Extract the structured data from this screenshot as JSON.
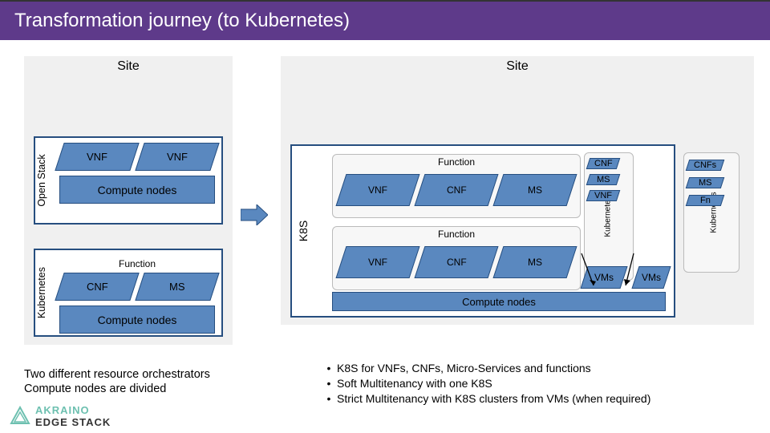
{
  "title": "Transformation journey (to Kubernetes)",
  "left_site": {
    "label": "Site",
    "openstack": {
      "vlabel": "Open Stack",
      "vnf1": "VNF",
      "vnf2": "VNF",
      "compute": "Compute nodes"
    },
    "kubernetes": {
      "vlabel": "Kubernetes",
      "function_label": "Function",
      "cnf": "CNF",
      "ms": "MS",
      "compute": "Compute nodes"
    }
  },
  "right_site": {
    "label": "Site",
    "k8s_vlabel": "K8S",
    "fn1": {
      "label": "Function",
      "vnf": "VNF",
      "cnf": "CNF",
      "ms": "MS"
    },
    "fn2": {
      "label": "Function",
      "vnf": "VNF",
      "cnf": "CNF",
      "ms": "MS"
    },
    "compute": "Compute nodes",
    "kub_inner": {
      "vlabel": "Kubernetes",
      "cnf": "CNF",
      "ms": "MS",
      "vnf": "VNF"
    },
    "kub_outer": {
      "vlabel": "Kubernetes",
      "cnfs": "CNFs",
      "ms": "MS",
      "fn": "Fn"
    },
    "vms_left": "VMs",
    "vms_right": "VMs"
  },
  "left_caption_line1": "Two different resource orchestrators",
  "left_caption_line2": "Compute nodes are divided",
  "bullets": [
    "K8S for VNFs, CNFs, Micro-Services and functions",
    "Soft Multitenancy with one K8S",
    "Strict Multitenancy with K8S clusters from VMs (when required)"
  ],
  "logo": {
    "part1": "AKRAINO",
    "part2": "EDGE STACK"
  }
}
